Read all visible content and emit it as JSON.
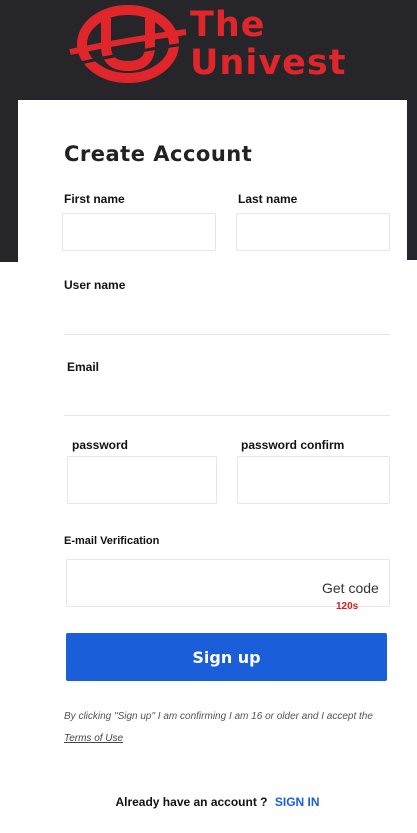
{
  "brand": {
    "logo_line1": "The",
    "logo_line2": "Univest",
    "color": "#e0262a"
  },
  "form": {
    "title": "Create Account",
    "first_name_label": "First name",
    "last_name_label": "Last name",
    "username_label": "User name",
    "email_label": "Email",
    "password_label": "password",
    "password_confirm_label": "password confirm",
    "verification_label": "E-mail Verification",
    "get_code_label": "Get code",
    "timer": "120s",
    "submit_label": "Sign up",
    "terms_prefix": "By clicking \"Sign up\" I am confirming I am 16 or older and I accept the",
    "terms_link": "Terms of Use",
    "already_text": "Already have an account ?",
    "signin_link": "SIGN IN"
  },
  "colors": {
    "header_bg": "#26262a",
    "primary": "#1a5ed9",
    "timer": "#d81c1c"
  }
}
